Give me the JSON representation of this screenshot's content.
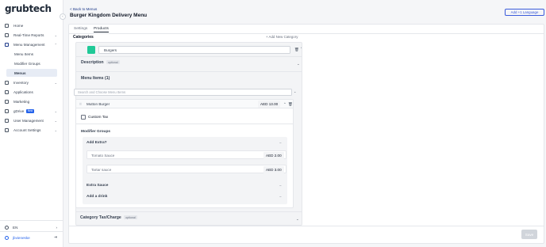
{
  "brand": {
    "logo_text": "grubtech"
  },
  "sidebar": {
    "items": [
      {
        "label": "Home",
        "icon": "home-icon"
      },
      {
        "label": "Real-Time Reports",
        "icon": "chart-icon"
      },
      {
        "label": "Menu Management",
        "icon": "menu-book-icon"
      },
      {
        "label": "Inventory",
        "icon": "box-icon"
      },
      {
        "label": "Applications",
        "icon": "monitor-icon"
      },
      {
        "label": "Marketing",
        "icon": "megaphone-icon"
      },
      {
        "label": "gDrive",
        "icon": "cart-icon",
        "badge": "New"
      },
      {
        "label": "User Management",
        "icon": "users-icon"
      },
      {
        "label": "Account Settings",
        "icon": "gear-icon"
      }
    ],
    "sub_items": [
      {
        "label": "Menu Items"
      },
      {
        "label": "Modifier Groups"
      },
      {
        "label": "Menus",
        "active": true
      }
    ],
    "language": "EN",
    "user": "jbvieneske"
  },
  "header": {
    "back_label": "< Back to Menus",
    "title": "Burger Kingdom Delivery Menu",
    "language_button": "Add +1 Language"
  },
  "tabs": [
    {
      "label": "Settings",
      "active": false
    },
    {
      "label": "Products",
      "active": true
    }
  ],
  "categories": {
    "label": "Categories",
    "add_label": "+ Add New Category",
    "category": {
      "name": "Burgers",
      "color": "#20c997",
      "description_label": "Description",
      "optional_label": "optional",
      "menu_items_label": "Menu Items (1)",
      "search_placeholder": "Search and Choose Menu Items",
      "tax_label": "Category Tax/Charge"
    }
  },
  "menu_item": {
    "name": "Mutton Burger",
    "price": "AED 13.00",
    "custom_tax_label": "Custom Tax",
    "custom_tax_checked": false,
    "modifier_groups_label": "Modifier Groups",
    "groups": [
      {
        "name": "Add Extra?",
        "expanded": true,
        "options": [
          {
            "name": "Tomato Sauce",
            "price": "AED 2.00"
          },
          {
            "name": "Tartar sauce",
            "price": "AED 3.00"
          }
        ]
      },
      {
        "name": "Extra Sauce",
        "expanded": false
      },
      {
        "name": "Add a drink",
        "expanded": false
      }
    ]
  },
  "footer": {
    "save_label": "Save"
  }
}
